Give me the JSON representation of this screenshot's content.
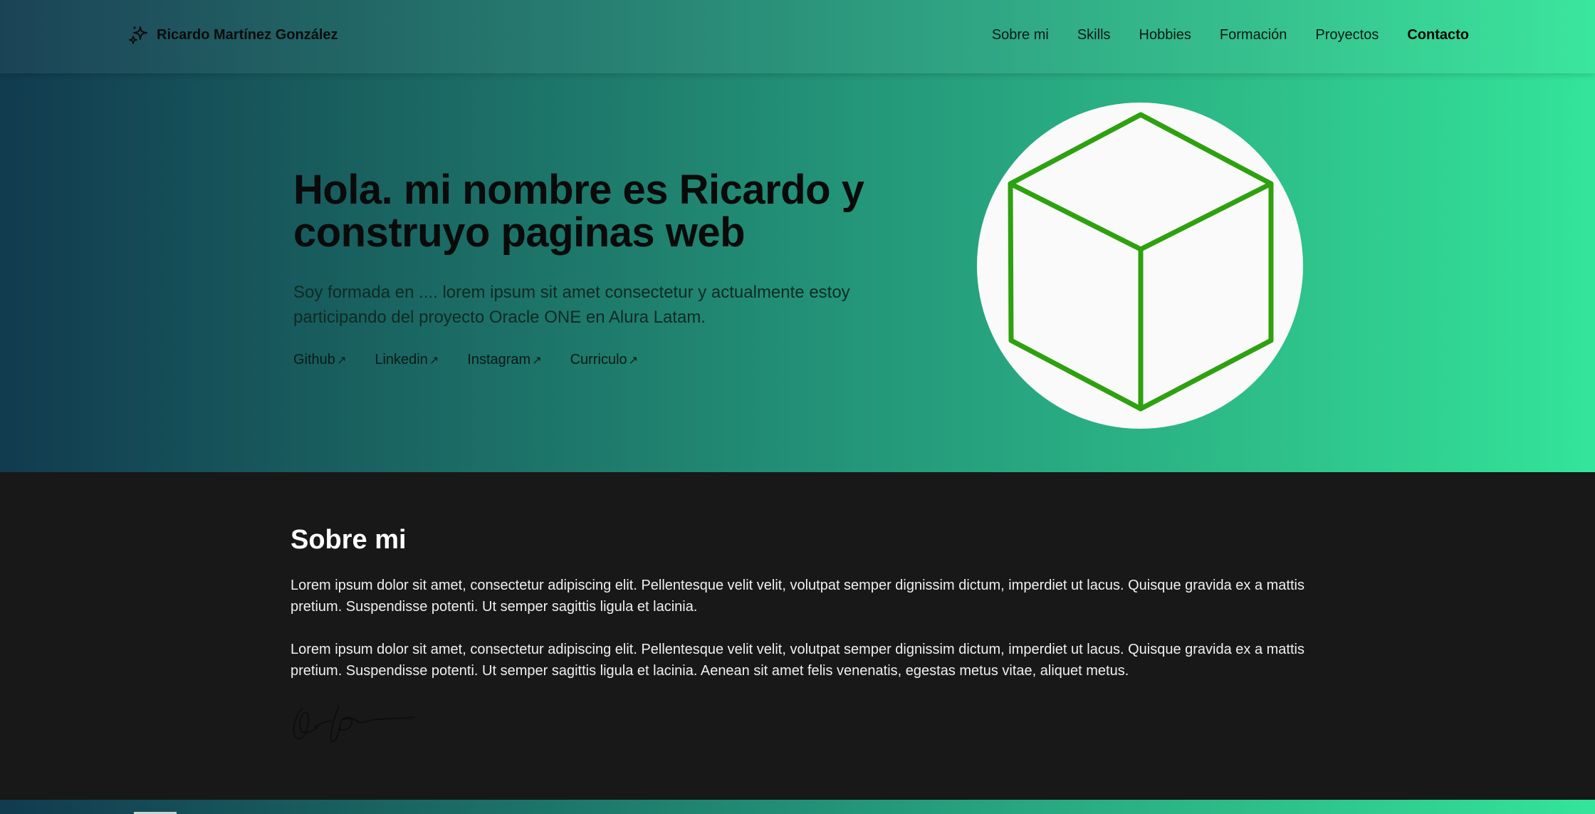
{
  "header": {
    "brand": "Ricardo Martínez González",
    "brand_icon": "sparkles-icon",
    "nav": [
      {
        "label": "Sobre mi"
      },
      {
        "label": "Skills"
      },
      {
        "label": "Hobbies"
      },
      {
        "label": "Formación"
      },
      {
        "label": "Proyectos"
      },
      {
        "label": "Contacto"
      }
    ]
  },
  "hero": {
    "title": "Hola. mi nombre es Ricardo y construyo paginas web",
    "subtitle": "Soy formada en .... lorem ipsum sit amet consectetur y actualmente estoy participando del proyecto Oracle ONE en Alura Latam.",
    "links": [
      {
        "label": "Github",
        "icon": "arrow-up-right-icon"
      },
      {
        "label": "Linkedin",
        "icon": "arrow-up-right-icon"
      },
      {
        "label": "Instagram",
        "icon": "arrow-up-right-icon"
      },
      {
        "label": "Curriculo",
        "icon": "arrow-up-right-icon"
      }
    ],
    "image_icon": "cube-icon"
  },
  "about": {
    "title": "Sobre mi",
    "paragraph1": "Lorem ipsum dolor sit amet, consectetur adipiscing elit. Pellentesque velit velit, volutpat semper dignissim dictum, imperdiet ut lacus. Quisque gravida ex a mattis pretium. Suspendisse potenti. Ut semper sagittis ligula et lacinia.",
    "paragraph2": "Lorem ipsum dolor sit amet, consectetur adipiscing elit. Pellentesque velit velit, volutpat semper dignissim dictum, imperdiet ut lacus. Quisque gravida ex a mattis pretium. Suspendisse potenti. Ut semper sagittis ligula et lacinia. Aenean sit amet felis venenatis, egestas metus vitae, aliquet metus."
  },
  "colors": {
    "gradient_start": "#113b4f",
    "gradient_end": "#33e59a",
    "dark_bg": "#181818",
    "cube_green": "#2da10f"
  }
}
